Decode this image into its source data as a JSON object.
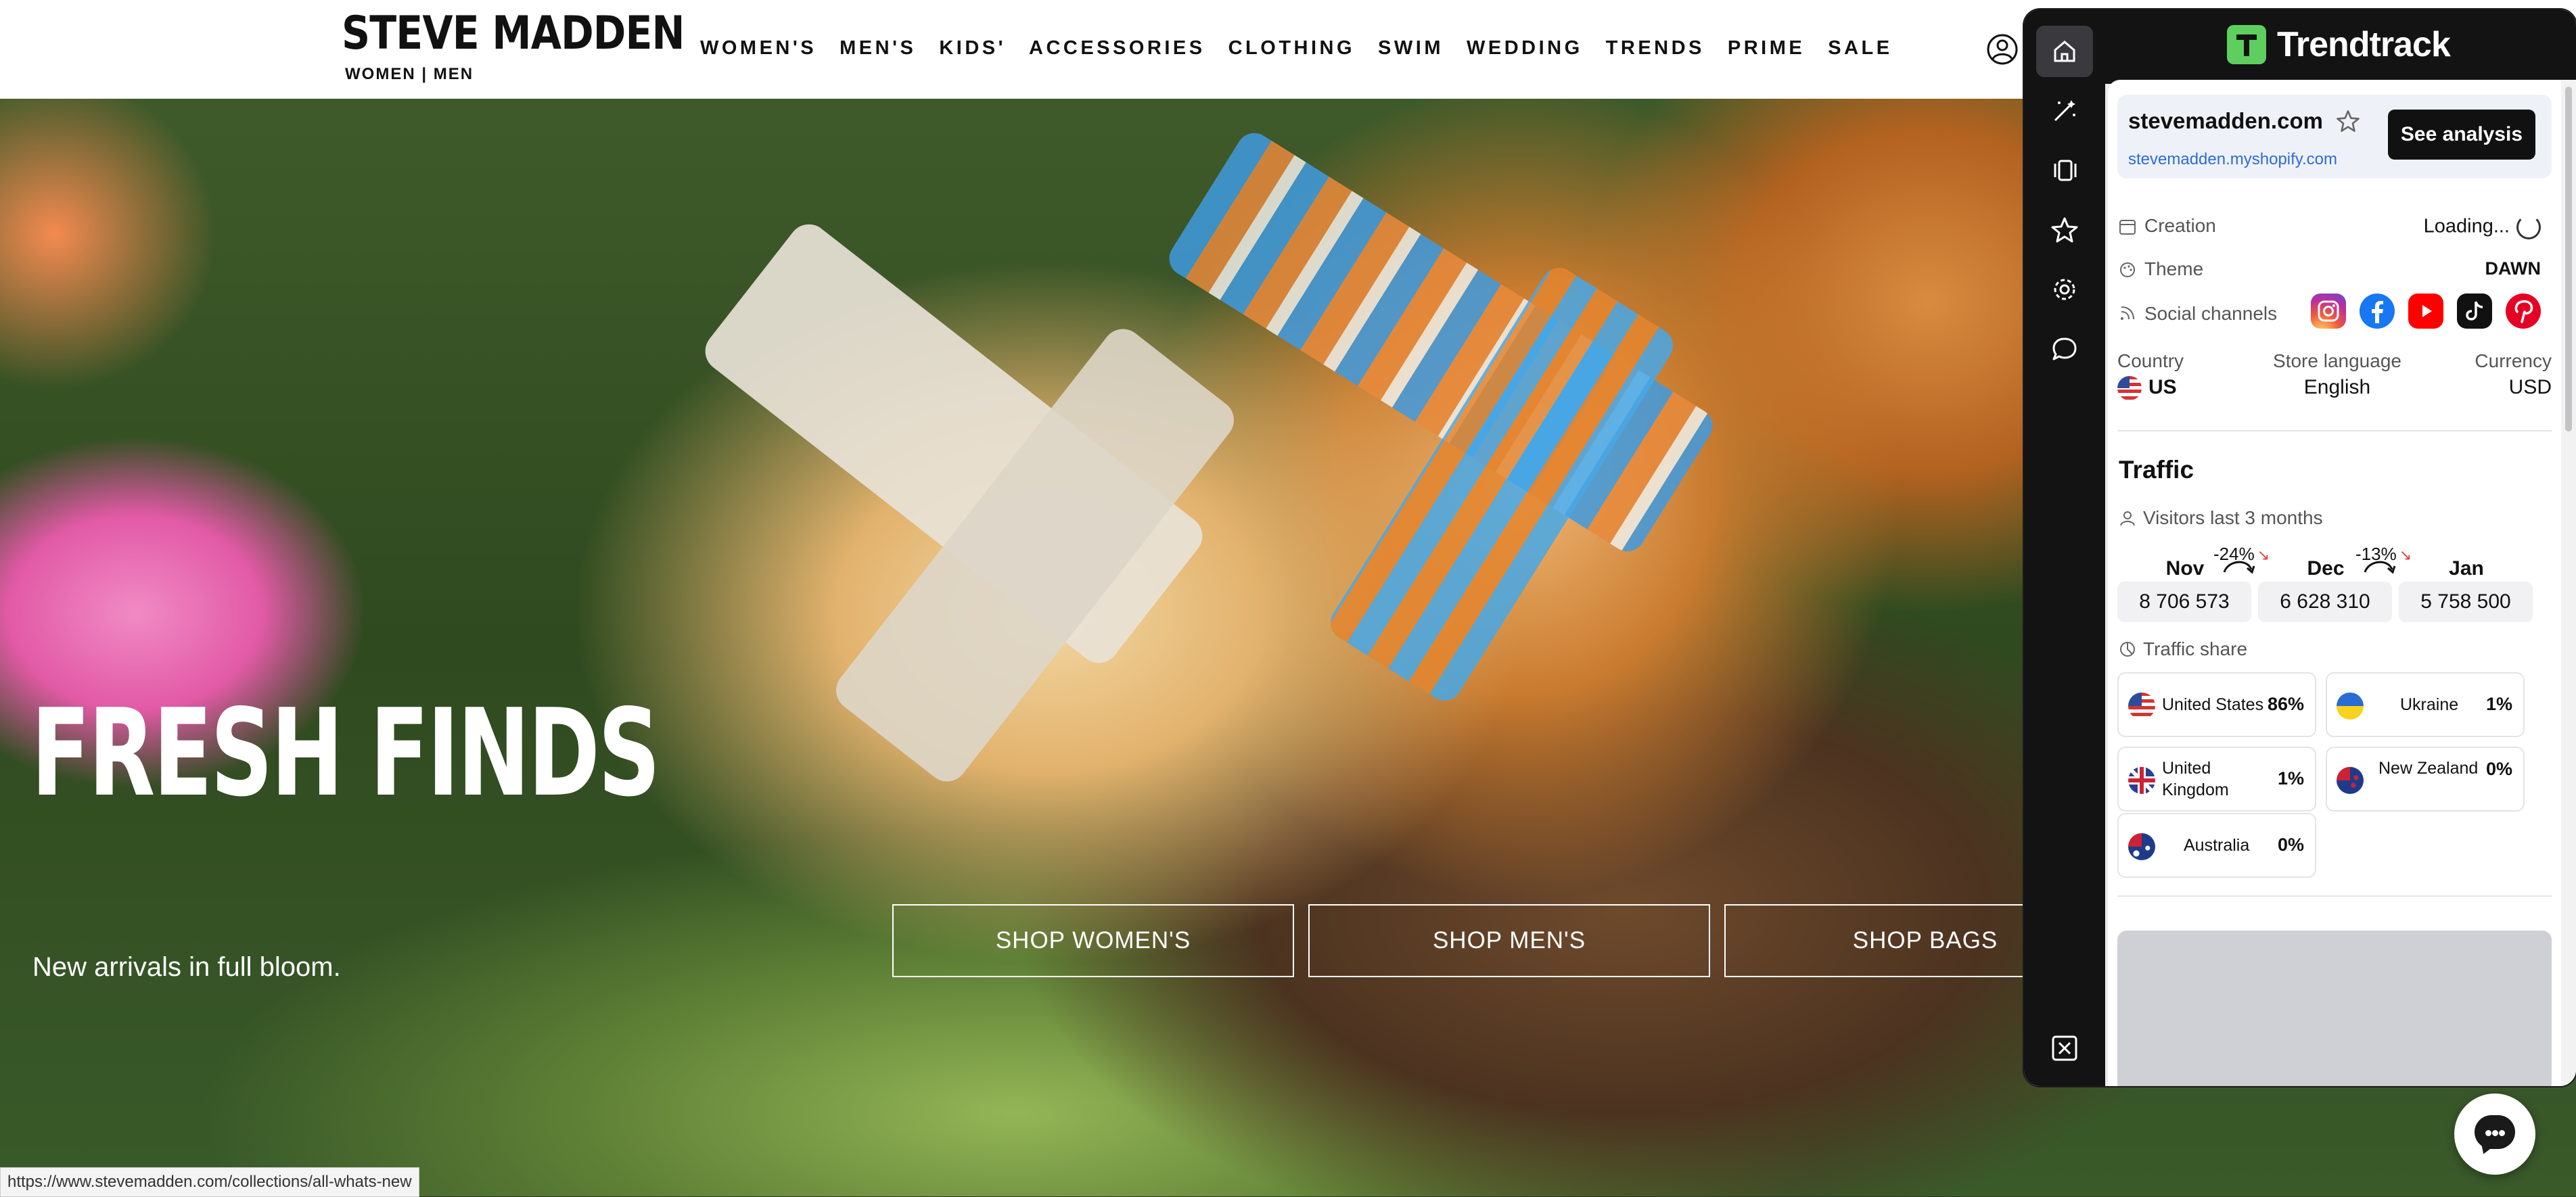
{
  "header": {
    "logo": "STEVE MADDEN",
    "logo_sub": "WOMEN | MEN",
    "nav": [
      "WOMEN'S",
      "MEN'S",
      "KIDS'",
      "ACCESSORIES",
      "CLOTHING",
      "SWIM",
      "WEDDING",
      "TRENDS",
      "PRIME",
      "SALE"
    ]
  },
  "hero": {
    "title": "FRESH FINDS",
    "subtitle": "New arrivals in full bloom.",
    "buttons": [
      "SHOP WOMEN'S",
      "SHOP MEN'S",
      "SHOP BAGS"
    ]
  },
  "status_url": "https://www.stevemadden.com/collections/all-whats-new",
  "panel": {
    "brand": "Trendtrack",
    "site": {
      "name": "stevemadden.com",
      "shop_url": "stevemadden.myshopify.com",
      "see_analysis": "See analysis"
    },
    "rows": {
      "creation_label": "Creation",
      "creation_value": "Loading...",
      "theme_label": "Theme",
      "theme_value": "DAWN",
      "social_label": "Social channels"
    },
    "social_icons": [
      "instagram-icon",
      "facebook-icon",
      "youtube-icon",
      "tiktok-icon",
      "pinterest-icon"
    ],
    "meta": {
      "country_label": "Country",
      "country_value": "US",
      "language_label": "Store language",
      "language_value": "English",
      "currency_label": "Currency",
      "currency_value": "USD"
    },
    "traffic": {
      "title": "Traffic",
      "visitors_label": "Visitors last 3 months",
      "months": [
        {
          "label": "Nov",
          "value": "8 706 573"
        },
        {
          "label": "Dec",
          "value": "6 628 310"
        },
        {
          "label": "Jan",
          "value": "5 758 500"
        }
      ],
      "changes": [
        "-24%",
        "-13%"
      ],
      "share_label": "Traffic share",
      "share": [
        {
          "country": "United States",
          "pct": "86%"
        },
        {
          "country": "Ukraine",
          "pct": "1%"
        },
        {
          "country": "United Kingdom",
          "pct": "1%"
        },
        {
          "country": "New Zealand",
          "pct": "0%"
        },
        {
          "country": "Australia",
          "pct": "0%"
        }
      ]
    }
  },
  "colors": {
    "panel_bg": "#131313",
    "brand_green": "#5ecf5e",
    "link_blue": "#2d6bd9",
    "decrease_red": "#e23c3c"
  }
}
